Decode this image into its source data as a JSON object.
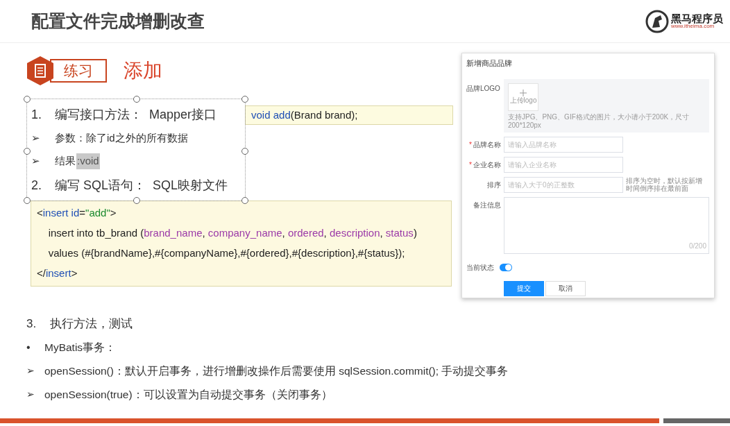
{
  "title": "配置文件完成增删改查",
  "logo": {
    "name": "黑马程序员",
    "url": "www.itheima.com"
  },
  "exercise": {
    "badge": "练习",
    "heading": "添加"
  },
  "steps": [
    {
      "kind": "numbered",
      "marker": "1.",
      "text": "编写接口方法：  Mapper接口"
    },
    {
      "kind": "arrow",
      "marker": "➢",
      "text": "参数：除了id之外的所有数据"
    },
    {
      "kind": "arrow",
      "marker": "➢",
      "text": "结果",
      "selected_text": ":void"
    },
    {
      "kind": "numbered",
      "marker": "2.",
      "text": "编写 SQL语句：  SQL映射文件"
    }
  ],
  "signature": [
    {
      "kind": "keyword",
      "text": "void"
    },
    {
      "kind": "method",
      "text": " add"
    },
    {
      "kind": "plain",
      "text": "(Brand brand);"
    }
  ],
  "code": [
    [
      {
        "kind": "plain",
        "text": "<"
      },
      {
        "kind": "tag",
        "text": "insert id"
      },
      {
        "kind": "plain",
        "text": "="
      },
      {
        "kind": "string",
        "text": "\"add\""
      },
      {
        "kind": "plain",
        "text": ">"
      }
    ],
    [
      {
        "kind": "plain",
        "text": "    insert into tb_brand ("
      },
      {
        "kind": "column",
        "text": "brand_name"
      },
      {
        "kind": "plain",
        "text": ", "
      },
      {
        "kind": "column",
        "text": "company_name"
      },
      {
        "kind": "plain",
        "text": ", "
      },
      {
        "kind": "column",
        "text": "ordered"
      },
      {
        "kind": "plain",
        "text": ", "
      },
      {
        "kind": "column",
        "text": "description"
      },
      {
        "kind": "plain",
        "text": ", "
      },
      {
        "kind": "column",
        "text": "status"
      },
      {
        "kind": "plain",
        "text": ")"
      }
    ],
    [
      {
        "kind": "plain",
        "text": "    values (#{brandName},#{companyName},#{ordered},#{description},#{status});"
      }
    ],
    [
      {
        "kind": "plain",
        "text": "</"
      },
      {
        "kind": "tag",
        "text": "insert"
      },
      {
        "kind": "plain",
        "text": ">"
      }
    ]
  ],
  "notes": [
    {
      "kind": "numbered",
      "marker": "3.",
      "text": "执行方法，测试"
    },
    {
      "kind": "bullet",
      "marker": "•",
      "text": "MyBatis事务："
    },
    {
      "kind": "arrow",
      "marker": "➢",
      "text": "openSession()：默认开启事务，进行增删改操作后需要使用 sqlSession.commit(); 手动提交事务"
    },
    {
      "kind": "arrow",
      "marker": "➢",
      "text": "openSession(true)：可以设置为自动提交事务（关闭事务）"
    }
  ],
  "form": {
    "title": "新增商品品牌",
    "logo": {
      "label": "品牌LOGO",
      "upload": "上传logo",
      "hint": "支持JPG、PNG、GIF格式的图片，大小请小于200K，尺寸200*120px"
    },
    "fields": [
      {
        "required_mark": "*",
        "label": "品牌名称",
        "placeholder": "请输入品牌名称"
      },
      {
        "required_mark": "*",
        "label": "企业名称",
        "placeholder": "请输入企业名称"
      },
      {
        "label": "排序",
        "placeholder": "请输入大于0的正整数",
        "hint": "排序为空时，默认按新增时间倒序排在最前面"
      }
    ],
    "remarks": {
      "label": "备注信息",
      "counter": "0/200"
    },
    "status": {
      "label": "当前状态",
      "on": true
    },
    "buttons": [
      {
        "kind": "primary",
        "label": "提交"
      },
      {
        "kind": "default",
        "label": "取消"
      }
    ]
  }
}
